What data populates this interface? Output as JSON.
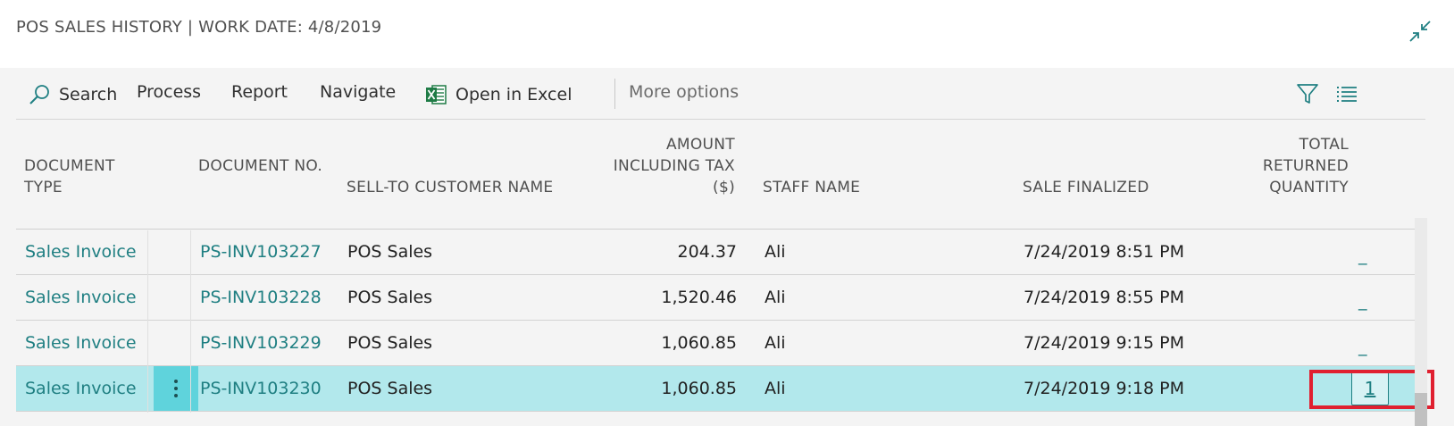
{
  "window": {
    "title": "POS SALES HISTORY | WORK DATE: 4/8/2019",
    "collapse_icon": "collapse-arrows-icon"
  },
  "actions": {
    "search": "Search",
    "process": "Process",
    "report": "Report",
    "navigate": "Navigate",
    "open_in_excel": "Open in Excel",
    "more_options": "More options",
    "filter_icon": "filter-icon",
    "list_view_icon": "list-view-icon"
  },
  "columns": {
    "document_type": "DOCUMENT TYPE",
    "document_no": "DOCUMENT NO.",
    "customer_name": "SELL-TO CUSTOMER NAME",
    "amount": "AMOUNT INCLUDING TAX ($)",
    "staff_name": "STAFF NAME",
    "sale_finalized": "SALE FINALIZED",
    "returned_qty": "TOTAL RETURNED QUANTITY"
  },
  "rows": [
    {
      "document_type": "Sales Invoice",
      "document_no": "PS-INV103227",
      "customer_name": "POS Sales",
      "amount": "204.37",
      "staff_name": "Ali",
      "sale_finalized": "7/24/2019 8:51 PM",
      "returned_qty": "_"
    },
    {
      "document_type": "Sales Invoice",
      "document_no": "PS-INV103228",
      "customer_name": "POS Sales",
      "amount": "1,520.46",
      "staff_name": "Ali",
      "sale_finalized": "7/24/2019 8:55 PM",
      "returned_qty": "_"
    },
    {
      "document_type": "Sales Invoice",
      "document_no": "PS-INV103229",
      "customer_name": "POS Sales",
      "amount": "1,060.85",
      "staff_name": "Ali",
      "sale_finalized": "7/24/2019 9:15 PM",
      "returned_qty": "_"
    },
    {
      "document_type": "Sales Invoice",
      "document_no": "PS-INV103230",
      "customer_name": "POS Sales",
      "amount": "1,060.85",
      "staff_name": "Ali",
      "sale_finalized": "7/24/2019 9:18 PM",
      "returned_qty": "1"
    }
  ],
  "colors": {
    "accent": "#1f7f82",
    "selected_row": "#b2e8ec",
    "highlight_border": "#e02030"
  }
}
